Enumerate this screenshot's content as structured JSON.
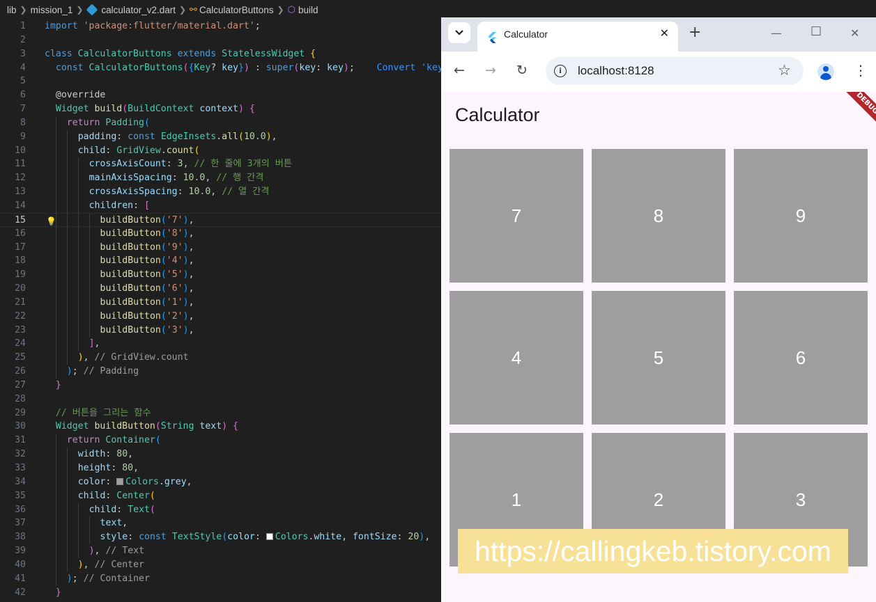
{
  "breadcrumb": {
    "items": [
      "lib",
      "mission_1",
      "calculator_v2.dart",
      "CalculatorButtons",
      "build"
    ]
  },
  "editor": {
    "active_line": 15,
    "lines": [
      {
        "n": "1",
        "indent": 0,
        "tokens": [
          [
            "kw",
            "import"
          ],
          [
            "p",
            " "
          ],
          [
            "str",
            "'package:flutter/material.dart'"
          ],
          [
            "p",
            ";"
          ]
        ]
      },
      {
        "n": "2",
        "indent": 0,
        "tokens": []
      },
      {
        "n": "3",
        "indent": 0,
        "tokens": [
          [
            "kw",
            "class"
          ],
          [
            "p",
            " "
          ],
          [
            "cls",
            "CalculatorButtons"
          ],
          [
            "p",
            " "
          ],
          [
            "kw",
            "extends"
          ],
          [
            "p",
            " "
          ],
          [
            "cls",
            "StatelessWidget"
          ],
          [
            "p",
            " "
          ],
          [
            "b1",
            "{"
          ]
        ]
      },
      {
        "n": "4",
        "indent": 1,
        "tokens": [
          [
            "kw",
            "const"
          ],
          [
            "p",
            " "
          ],
          [
            "cls",
            "CalculatorButtons"
          ],
          [
            "b2",
            "("
          ],
          [
            "b3",
            "{"
          ],
          [
            "cls",
            "Key"
          ],
          [
            "p",
            "? "
          ],
          [
            "var",
            "key"
          ],
          [
            "b3",
            "}"
          ],
          [
            "b2",
            ")"
          ],
          [
            "p",
            " : "
          ],
          [
            "kw",
            "super"
          ],
          [
            "b2",
            "("
          ],
          [
            "var",
            "key"
          ],
          [
            "p",
            ": "
          ],
          [
            "var",
            "key"
          ],
          [
            "b2",
            ")"
          ],
          [
            "p",
            ";"
          ],
          [
            "p",
            "    "
          ],
          [
            "hint",
            "Convert 'key"
          ]
        ]
      },
      {
        "n": "5",
        "indent": 1,
        "tokens": []
      },
      {
        "n": "6",
        "indent": 1,
        "tokens": [
          [
            "p",
            "@override"
          ]
        ]
      },
      {
        "n": "7",
        "indent": 1,
        "tokens": [
          [
            "cls",
            "Widget"
          ],
          [
            "p",
            " "
          ],
          [
            "fn",
            "build"
          ],
          [
            "b2",
            "("
          ],
          [
            "cls",
            "BuildContext"
          ],
          [
            "p",
            " "
          ],
          [
            "var",
            "context"
          ],
          [
            "b2",
            ")"
          ],
          [
            "p",
            " "
          ],
          [
            "b2",
            "{"
          ]
        ]
      },
      {
        "n": "8",
        "indent": 2,
        "tokens": [
          [
            "kc",
            "return"
          ],
          [
            "p",
            " "
          ],
          [
            "cls",
            "Padding"
          ],
          [
            "b3",
            "("
          ]
        ]
      },
      {
        "n": "9",
        "indent": 3,
        "tokens": [
          [
            "var",
            "padding"
          ],
          [
            "p",
            ": "
          ],
          [
            "kw",
            "const"
          ],
          [
            "p",
            " "
          ],
          [
            "cls",
            "EdgeInsets"
          ],
          [
            "p",
            "."
          ],
          [
            "fn",
            "all"
          ],
          [
            "b1",
            "("
          ],
          [
            "num",
            "10.0"
          ],
          [
            "b1",
            ")"
          ],
          [
            "p",
            ","
          ]
        ]
      },
      {
        "n": "10",
        "indent": 3,
        "tokens": [
          [
            "var",
            "child"
          ],
          [
            "p",
            ": "
          ],
          [
            "cls",
            "GridView"
          ],
          [
            "p",
            "."
          ],
          [
            "fn",
            "count"
          ],
          [
            "b1",
            "("
          ]
        ]
      },
      {
        "n": "11",
        "indent": 4,
        "tokens": [
          [
            "var",
            "crossAxisCount"
          ],
          [
            "p",
            ": "
          ],
          [
            "num",
            "3"
          ],
          [
            "p",
            ", "
          ],
          [
            "cm",
            "// 한 줄에 3개의 버튼"
          ]
        ]
      },
      {
        "n": "12",
        "indent": 4,
        "tokens": [
          [
            "var",
            "mainAxisSpacing"
          ],
          [
            "p",
            ": "
          ],
          [
            "num",
            "10.0"
          ],
          [
            "p",
            ", "
          ],
          [
            "cm",
            "// 행 간격"
          ]
        ]
      },
      {
        "n": "13",
        "indent": 4,
        "tokens": [
          [
            "var",
            "crossAxisSpacing"
          ],
          [
            "p",
            ": "
          ],
          [
            "num",
            "10.0"
          ],
          [
            "p",
            ", "
          ],
          [
            "cm",
            "// 열 간격"
          ]
        ]
      },
      {
        "n": "14",
        "indent": 4,
        "tokens": [
          [
            "var",
            "children"
          ],
          [
            "p",
            ": "
          ],
          [
            "b2",
            "["
          ]
        ]
      },
      {
        "n": "15",
        "indent": 5,
        "tokens": [
          [
            "fn",
            "buildButton"
          ],
          [
            "b3",
            "("
          ],
          [
            "str",
            "'7'"
          ],
          [
            "b3",
            ")"
          ],
          [
            "p",
            ","
          ]
        ]
      },
      {
        "n": "16",
        "indent": 5,
        "tokens": [
          [
            "fn",
            "buildButton"
          ],
          [
            "b3",
            "("
          ],
          [
            "str",
            "'8'"
          ],
          [
            "b3",
            ")"
          ],
          [
            "p",
            ","
          ]
        ]
      },
      {
        "n": "17",
        "indent": 5,
        "tokens": [
          [
            "fn",
            "buildButton"
          ],
          [
            "b3",
            "("
          ],
          [
            "str",
            "'9'"
          ],
          [
            "b3",
            ")"
          ],
          [
            "p",
            ","
          ]
        ]
      },
      {
        "n": "18",
        "indent": 5,
        "tokens": [
          [
            "fn",
            "buildButton"
          ],
          [
            "b3",
            "("
          ],
          [
            "str",
            "'4'"
          ],
          [
            "b3",
            ")"
          ],
          [
            "p",
            ","
          ]
        ]
      },
      {
        "n": "19",
        "indent": 5,
        "tokens": [
          [
            "fn",
            "buildButton"
          ],
          [
            "b3",
            "("
          ],
          [
            "str",
            "'5'"
          ],
          [
            "b3",
            ")"
          ],
          [
            "p",
            ","
          ]
        ]
      },
      {
        "n": "20",
        "indent": 5,
        "tokens": [
          [
            "fn",
            "buildButton"
          ],
          [
            "b3",
            "("
          ],
          [
            "str",
            "'6'"
          ],
          [
            "b3",
            ")"
          ],
          [
            "p",
            ","
          ]
        ]
      },
      {
        "n": "21",
        "indent": 5,
        "tokens": [
          [
            "fn",
            "buildButton"
          ],
          [
            "b3",
            "("
          ],
          [
            "str",
            "'1'"
          ],
          [
            "b3",
            ")"
          ],
          [
            "p",
            ","
          ]
        ]
      },
      {
        "n": "22",
        "indent": 5,
        "tokens": [
          [
            "fn",
            "buildButton"
          ],
          [
            "b3",
            "("
          ],
          [
            "str",
            "'2'"
          ],
          [
            "b3",
            ")"
          ],
          [
            "p",
            ","
          ]
        ]
      },
      {
        "n": "23",
        "indent": 5,
        "tokens": [
          [
            "fn",
            "buildButton"
          ],
          [
            "b3",
            "("
          ],
          [
            "str",
            "'3'"
          ],
          [
            "b3",
            ")"
          ],
          [
            "p",
            ","
          ]
        ]
      },
      {
        "n": "24",
        "indent": 4,
        "tokens": [
          [
            "b2",
            "]"
          ],
          [
            "p",
            ","
          ]
        ]
      },
      {
        "n": "25",
        "indent": 3,
        "tokens": [
          [
            "b1",
            ")"
          ],
          [
            "p",
            ", "
          ],
          [
            "gr",
            "// GridView.count"
          ]
        ]
      },
      {
        "n": "26",
        "indent": 2,
        "tokens": [
          [
            "b3",
            ")"
          ],
          [
            "p",
            "; "
          ],
          [
            "gr",
            "// Padding"
          ]
        ]
      },
      {
        "n": "27",
        "indent": 1,
        "tokens": [
          [
            "b2",
            "}"
          ]
        ]
      },
      {
        "n": "28",
        "indent": 1,
        "tokens": []
      },
      {
        "n": "29",
        "indent": 1,
        "tokens": [
          [
            "cm",
            "// 버튼을 그리는 함수"
          ]
        ]
      },
      {
        "n": "30",
        "indent": 1,
        "tokens": [
          [
            "cls",
            "Widget"
          ],
          [
            "p",
            " "
          ],
          [
            "fn",
            "buildButton"
          ],
          [
            "b2",
            "("
          ],
          [
            "cls",
            "String"
          ],
          [
            "p",
            " "
          ],
          [
            "var",
            "text"
          ],
          [
            "b2",
            ")"
          ],
          [
            "p",
            " "
          ],
          [
            "b2",
            "{"
          ]
        ]
      },
      {
        "n": "31",
        "indent": 2,
        "tokens": [
          [
            "kc",
            "return"
          ],
          [
            "p",
            " "
          ],
          [
            "cls",
            "Container"
          ],
          [
            "b3",
            "("
          ]
        ]
      },
      {
        "n": "32",
        "indent": 3,
        "tokens": [
          [
            "var",
            "width"
          ],
          [
            "p",
            ": "
          ],
          [
            "num",
            "80"
          ],
          [
            "p",
            ","
          ]
        ]
      },
      {
        "n": "33",
        "indent": 3,
        "tokens": [
          [
            "var",
            "height"
          ],
          [
            "p",
            ": "
          ],
          [
            "num",
            "80"
          ],
          [
            "p",
            ","
          ]
        ]
      },
      {
        "n": "34",
        "indent": 3,
        "tokens": [
          [
            "var",
            "color"
          ],
          [
            "p",
            ": "
          ],
          [
            "swatch",
            "#9e9e9e"
          ],
          [
            "cls",
            "Colors"
          ],
          [
            "p",
            "."
          ],
          [
            "var",
            "grey"
          ],
          [
            "p",
            ","
          ]
        ]
      },
      {
        "n": "35",
        "indent": 3,
        "tokens": [
          [
            "var",
            "child"
          ],
          [
            "p",
            ": "
          ],
          [
            "cls",
            "Center"
          ],
          [
            "b1",
            "("
          ]
        ]
      },
      {
        "n": "36",
        "indent": 4,
        "tokens": [
          [
            "var",
            "child"
          ],
          [
            "p",
            ": "
          ],
          [
            "cls",
            "Text"
          ],
          [
            "b2",
            "("
          ]
        ]
      },
      {
        "n": "37",
        "indent": 5,
        "tokens": [
          [
            "var",
            "text"
          ],
          [
            "p",
            ","
          ]
        ]
      },
      {
        "n": "38",
        "indent": 5,
        "tokens": [
          [
            "var",
            "style"
          ],
          [
            "p",
            ": "
          ],
          [
            "kw",
            "const"
          ],
          [
            "p",
            " "
          ],
          [
            "cls",
            "TextStyle"
          ],
          [
            "b3",
            "("
          ],
          [
            "var",
            "color"
          ],
          [
            "p",
            ": "
          ],
          [
            "swatch",
            "#ffffff"
          ],
          [
            "cls",
            "Colors"
          ],
          [
            "p",
            "."
          ],
          [
            "var",
            "white"
          ],
          [
            "p",
            ", "
          ],
          [
            "var",
            "fontSize"
          ],
          [
            "p",
            ": "
          ],
          [
            "num",
            "20"
          ],
          [
            "b3",
            ")"
          ],
          [
            "p",
            ","
          ]
        ]
      },
      {
        "n": "39",
        "indent": 4,
        "tokens": [
          [
            "b2",
            ")"
          ],
          [
            "p",
            ", "
          ],
          [
            "gr",
            "// Text"
          ]
        ]
      },
      {
        "n": "40",
        "indent": 3,
        "tokens": [
          [
            "b1",
            ")"
          ],
          [
            "p",
            ", "
          ],
          [
            "gr",
            "// Center"
          ]
        ]
      },
      {
        "n": "41",
        "indent": 2,
        "tokens": [
          [
            "b3",
            ")"
          ],
          [
            "p",
            "; "
          ],
          [
            "gr",
            "// Container"
          ]
        ]
      },
      {
        "n": "42",
        "indent": 1,
        "tokens": [
          [
            "b2",
            "}"
          ]
        ]
      }
    ]
  },
  "browser": {
    "tab_title": "Calculator",
    "url": "localhost:8128",
    "app_title": "Calculator",
    "debug_banner": "DEBUG",
    "buttons": [
      "7",
      "8",
      "9",
      "4",
      "5",
      "6",
      "1",
      "2",
      "3"
    ]
  },
  "watermark": "https://callingkeb.tistory.com",
  "colors": {
    "button_grey": "#9e9e9e",
    "page_background": "#fcf5fd",
    "debug_banner": "#b3262d",
    "watermark_background": "#f6e197"
  }
}
